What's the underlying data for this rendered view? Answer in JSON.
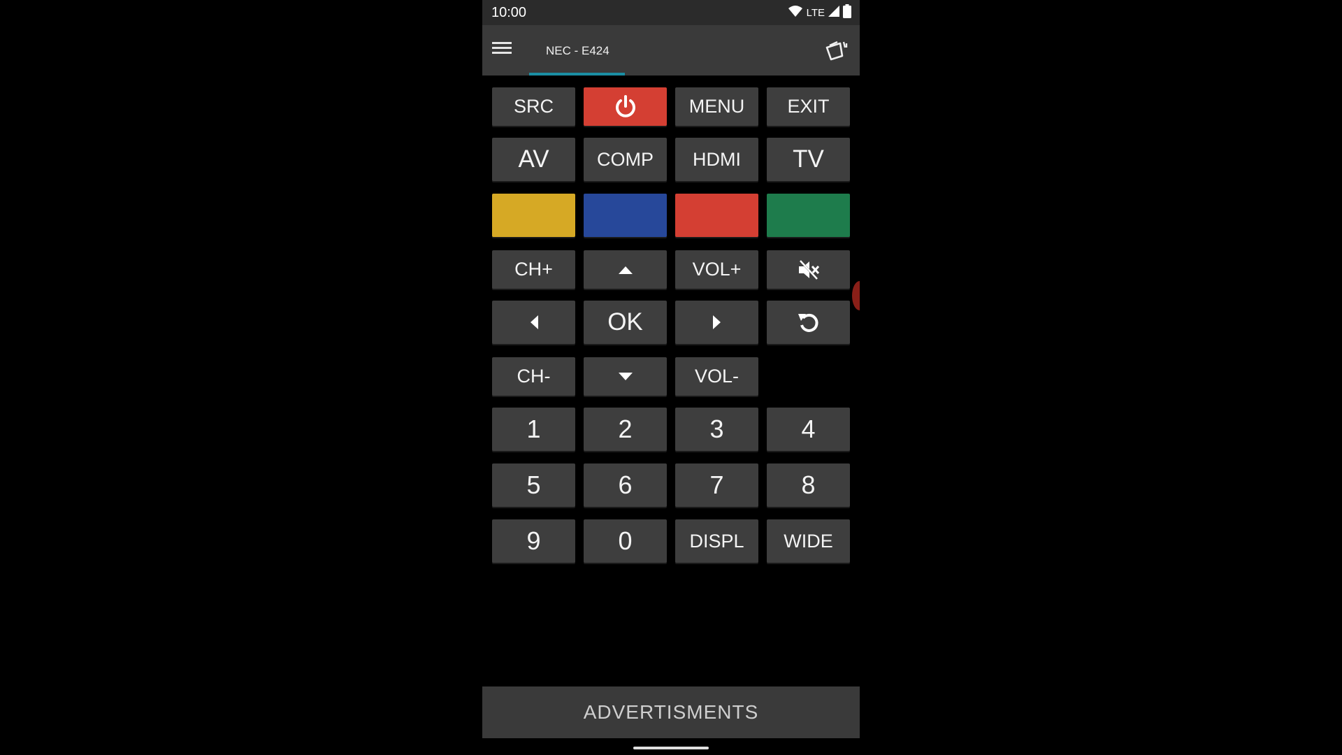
{
  "status_bar": {
    "time": "10:00",
    "network": "LTE",
    "icons": [
      "wifi-icon",
      "signal-icon",
      "battery-icon"
    ]
  },
  "app_bar": {
    "title": "NEC - E424",
    "menu_icon": "hamburger-menu-icon",
    "action_icon": "remote-devices-icon",
    "tab_indicator_color": "#1b8ea3"
  },
  "buttons": {
    "src": "SRC",
    "power_icon": "power-icon",
    "menu": "MENU",
    "exit": "EXIT",
    "av": "AV",
    "comp": "COMP",
    "hdmi": "HDMI",
    "tv": "TV",
    "ch_up": "CH+",
    "up_icon": "arrow-up-icon",
    "vol_up": "VOL+",
    "mute_icon": "mute-icon",
    "left_icon": "arrow-left-icon",
    "ok": "OK",
    "right_icon": "arrow-right-icon",
    "back_icon": "return-icon",
    "ch_down": "CH-",
    "down_icon": "arrow-down-icon",
    "vol_down": "VOL-",
    "digits": [
      "1",
      "2",
      "3",
      "4",
      "5",
      "6",
      "7",
      "8",
      "9",
      "0"
    ],
    "displ": "DISPL",
    "wide": "WIDE"
  },
  "colors": {
    "power": "#d43f33",
    "yellow": "#d6a925",
    "blue": "#27489a",
    "red": "#d43f33",
    "green": "#1e7c4c",
    "button_bg": "#3e3e3e"
  },
  "ad_banner": {
    "label": "ADVERTISMENTS"
  }
}
